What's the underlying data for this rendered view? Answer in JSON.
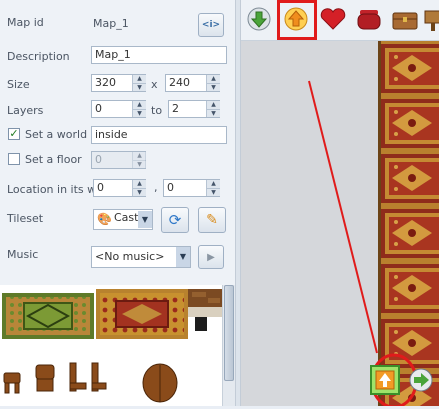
{
  "map_id": {
    "label": "Map id",
    "value": "Map_1"
  },
  "description": {
    "label": "Description",
    "value": "Map_1"
  },
  "size": {
    "label": "Size",
    "width": "320",
    "separator": "x",
    "height": "240"
  },
  "layers": {
    "label": "Layers",
    "from": "0",
    "separator": "to",
    "to": "2"
  },
  "world": {
    "label": "Set a world",
    "checked": true,
    "value": "inside"
  },
  "floor": {
    "label": "Set a floor",
    "checked": false,
    "value": "0"
  },
  "location": {
    "label": "Location in its w",
    "x": "0",
    "separator": ",",
    "y": "0"
  },
  "tileset": {
    "label": "Tileset",
    "value": "Cast"
  },
  "music": {
    "label": "Music",
    "value": "<No music>"
  },
  "colors": {
    "highlight": "#e01b1b",
    "carpet_red": "#8e2418",
    "carpet_gold": "#c98a34",
    "carpet_dark": "#7a4b16"
  },
  "toolbar_icons": [
    "arrow-down-green-icon",
    "arrow-up-orange-icon",
    "heart-icon",
    "pot-icon",
    "chest-icon",
    "sign-icon"
  ]
}
